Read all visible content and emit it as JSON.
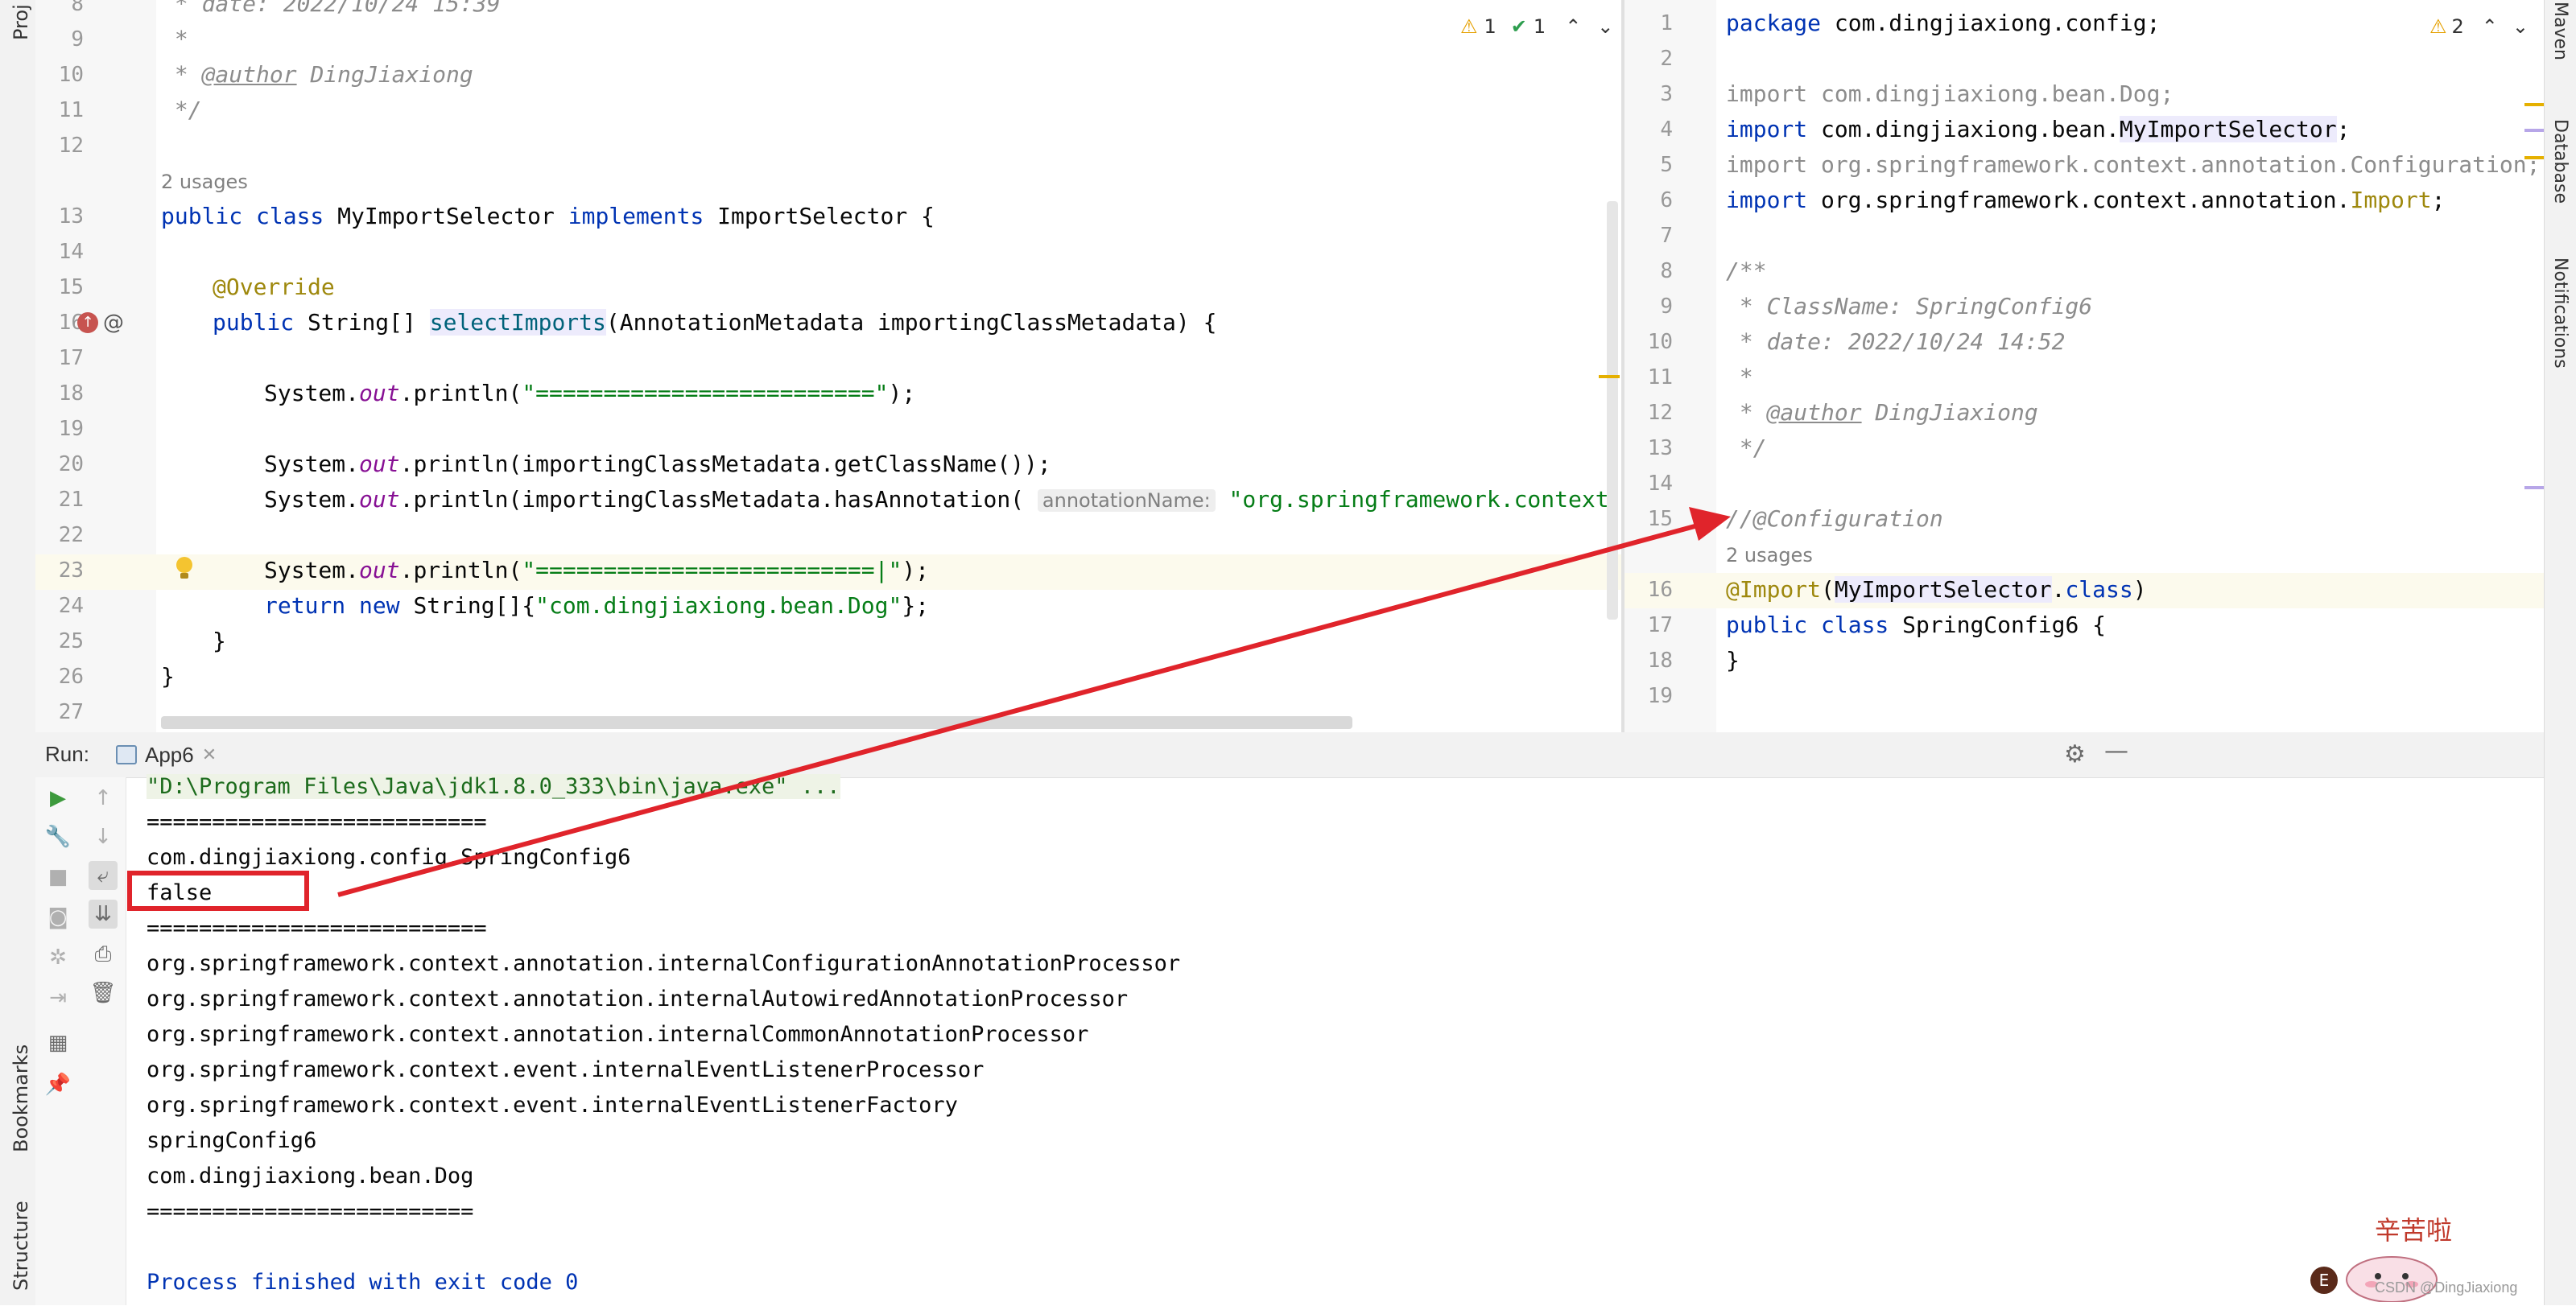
{
  "left_stripe": {
    "project_label": "Proj",
    "bookmarks_label": "Bookmarks",
    "structure_label": "Structure"
  },
  "right_stripe": {
    "maven_label": "Maven",
    "database_label": "Database",
    "notifications_label": "Notifications"
  },
  "left_editor": {
    "inspections": {
      "warnings": "1",
      "checks": "1"
    },
    "usages": "2 usages",
    "lines": [
      {
        "n": "8"
      },
      {
        "n": "9"
      },
      {
        "n": "10"
      },
      {
        "n": "11"
      },
      {
        "n": "12"
      },
      {
        "n": "13"
      },
      {
        "n": "14"
      },
      {
        "n": "15"
      },
      {
        "n": "16"
      },
      {
        "n": "17"
      },
      {
        "n": "18"
      },
      {
        "n": "19"
      },
      {
        "n": "20"
      },
      {
        "n": "21"
      },
      {
        "n": "22"
      },
      {
        "n": "23"
      },
      {
        "n": "24"
      },
      {
        "n": "25"
      },
      {
        "n": "26"
      },
      {
        "n": "27"
      }
    ],
    "code": {
      "l8": " * date: 2022/10/24 15:39",
      "l9": " *",
      "l10_a": " * ",
      "l10_b": "@author",
      "l10_c": " DingJiaxiong",
      "l11": " */",
      "l13_kw1": "public class ",
      "l13_name": "MyImportSelector ",
      "l13_kw2": "implements ",
      "l13_rest": "ImportSelector {",
      "l15": "@Override",
      "l16_kw": "public ",
      "l16_a": "String[] ",
      "l16_m": "selectImports",
      "l16_b": "(AnnotationMetadata importingClassMetadata) {",
      "l18_a": "System.",
      "l18_f": "out",
      "l18_b": ".println(",
      "l18_s": "\"=========================\"",
      "l18_c": ");",
      "l20_a": "System.",
      "l20_f": "out",
      "l20_b": ".println(importingClassMetadata.getClassName());",
      "l21_a": "System.",
      "l21_f": "out",
      "l21_b": ".println(importingClassMetadata.hasAnnotation(",
      "l21_hint": "annotationName:",
      "l21_s": " \"org.springframework.context.annota",
      "l23_a": "System.",
      "l23_f": "out",
      "l23_b": ".println(",
      "l23_s": "\"=========================|\"",
      "l23_c": ");",
      "l24_kw": "return new ",
      "l24_a": "String[]{",
      "l24_s": "\"com.dingjiaxiong.bean.Dog\"",
      "l24_c": "};",
      "l25": "}",
      "l26": "}"
    }
  },
  "right_editor": {
    "inspections": {
      "warnings": "2"
    },
    "usages": "2 usages",
    "lines": [
      {
        "n": "1"
      },
      {
        "n": "2"
      },
      {
        "n": "3"
      },
      {
        "n": "4"
      },
      {
        "n": "5"
      },
      {
        "n": "6"
      },
      {
        "n": "7"
      },
      {
        "n": "8"
      },
      {
        "n": "9"
      },
      {
        "n": "10"
      },
      {
        "n": "11"
      },
      {
        "n": "12"
      },
      {
        "n": "13"
      },
      {
        "n": "14"
      },
      {
        "n": "15"
      },
      {
        "n": "16"
      },
      {
        "n": "17"
      },
      {
        "n": "18"
      },
      {
        "n": "19"
      }
    ],
    "code": {
      "l1_kw": "package ",
      "l1_a": "com.dingjiaxiong.config;",
      "l3": "import com.dingjiaxiong.bean.Dog;",
      "l4_kw": "import ",
      "l4_a": "com.dingjiaxiong.bean.",
      "l4_b": "MyImportSelector",
      "l4_c": ";",
      "l5": "import org.springframework.context.annotation.Configuration;",
      "l6_kw": "import ",
      "l6_a": "org.springframework.context.annotation.",
      "l6_b": "Import",
      "l6_c": ";",
      "l8": "/**",
      "l9": " * ClassName: SpringConfig6",
      "l10": " * date: 2022/10/24 14:52",
      "l11": " *",
      "l12_a": " * ",
      "l12_b": "@author",
      "l12_c": " DingJiaxiong",
      "l13": " */",
      "l15": "//@Configuration",
      "l16_a": "@Import",
      "l16_b": "(",
      "l16_c": "MyImportSelector",
      "l16_d": ".",
      "l16_e": "class",
      "l16_f": ")",
      "l17_kw": "public class ",
      "l17_a": "SpringConfig6 {",
      "l18": "}"
    }
  },
  "run": {
    "label": "Run:",
    "tab": "App6",
    "console": [
      "\"D:\\Program Files\\Java\\jdk1.8.0_333\\bin\\java.exe\" ...",
      "==========================",
      "com.dingjiaxiong.config.SpringConfig6",
      "false",
      "==========================",
      "org.springframework.context.annotation.internalConfigurationAnnotationProcessor",
      "org.springframework.context.annotation.internalAutowiredAnnotationProcessor",
      "org.springframework.context.annotation.internalCommonAnnotationProcessor",
      "org.springframework.context.event.internalEventListenerProcessor",
      "org.springframework.context.event.internalEventListenerFactory",
      "springConfig6",
      "com.dingjiaxiong.bean.Dog",
      "=========================",
      "",
      "Process finished with exit code 0"
    ]
  },
  "watermark": {
    "text": "辛苦啦",
    "caption": "CSDN @DingJiaxiong"
  },
  "colors": {
    "annotation_box": "#e0242b",
    "arrow": "#e0242b"
  }
}
